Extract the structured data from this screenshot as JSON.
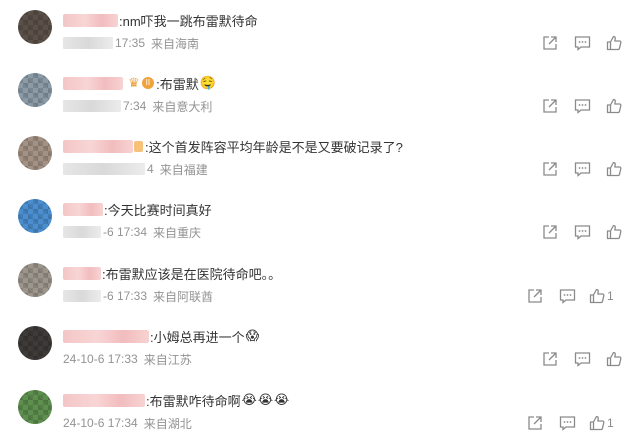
{
  "comments": [
    {
      "text": ":nm吓我一跳布雷默待命",
      "time_fragment": "17:35",
      "location": "来自海南",
      "badges": [],
      "emojis": [],
      "like_count": ""
    },
    {
      "text": ":布雷默",
      "time_fragment": "7:34",
      "location": "来自意大利",
      "badges": [
        "crown",
        "vip"
      ],
      "vip_label": "II",
      "emojis": [
        "🤤"
      ],
      "like_count": ""
    },
    {
      "text": ":这个首发阵容平均年龄是不是又要破记录了?",
      "time_fragment": "4",
      "location": "来自福建",
      "badges": [
        "suffix"
      ],
      "emojis": [],
      "like_count": ""
    },
    {
      "text": ":今天比赛时间真好",
      "time_fragment": "-6 17:34",
      "location": "来自重庆",
      "badges": [],
      "emojis": [],
      "like_count": ""
    },
    {
      "text": ":布雷默应该是在医院待命吧。。",
      "time_fragment": "-6 17:33",
      "location": "来自阿联酋",
      "badges": [],
      "emojis": [],
      "like_count": "1"
    },
    {
      "text": ":小姆总再进一个",
      "time_fragment": "24-10-6 17:33",
      "location": "来自江苏",
      "badges": [],
      "emojis": [
        "😱"
      ],
      "like_count": ""
    },
    {
      "text": ":布雷默咋待命啊",
      "time_fragment": "24-10-6 17:34",
      "location": "来自湖北",
      "badges": [],
      "emojis": [
        "😭",
        "😭",
        "😭"
      ],
      "like_count": "1"
    }
  ],
  "icons": {
    "share": "share-icon",
    "comment": "comment-icon",
    "like": "thumbs-up-icon"
  },
  "colors": {
    "text": "#333333",
    "meta": "#939393",
    "icon": "#8a8a8a"
  }
}
